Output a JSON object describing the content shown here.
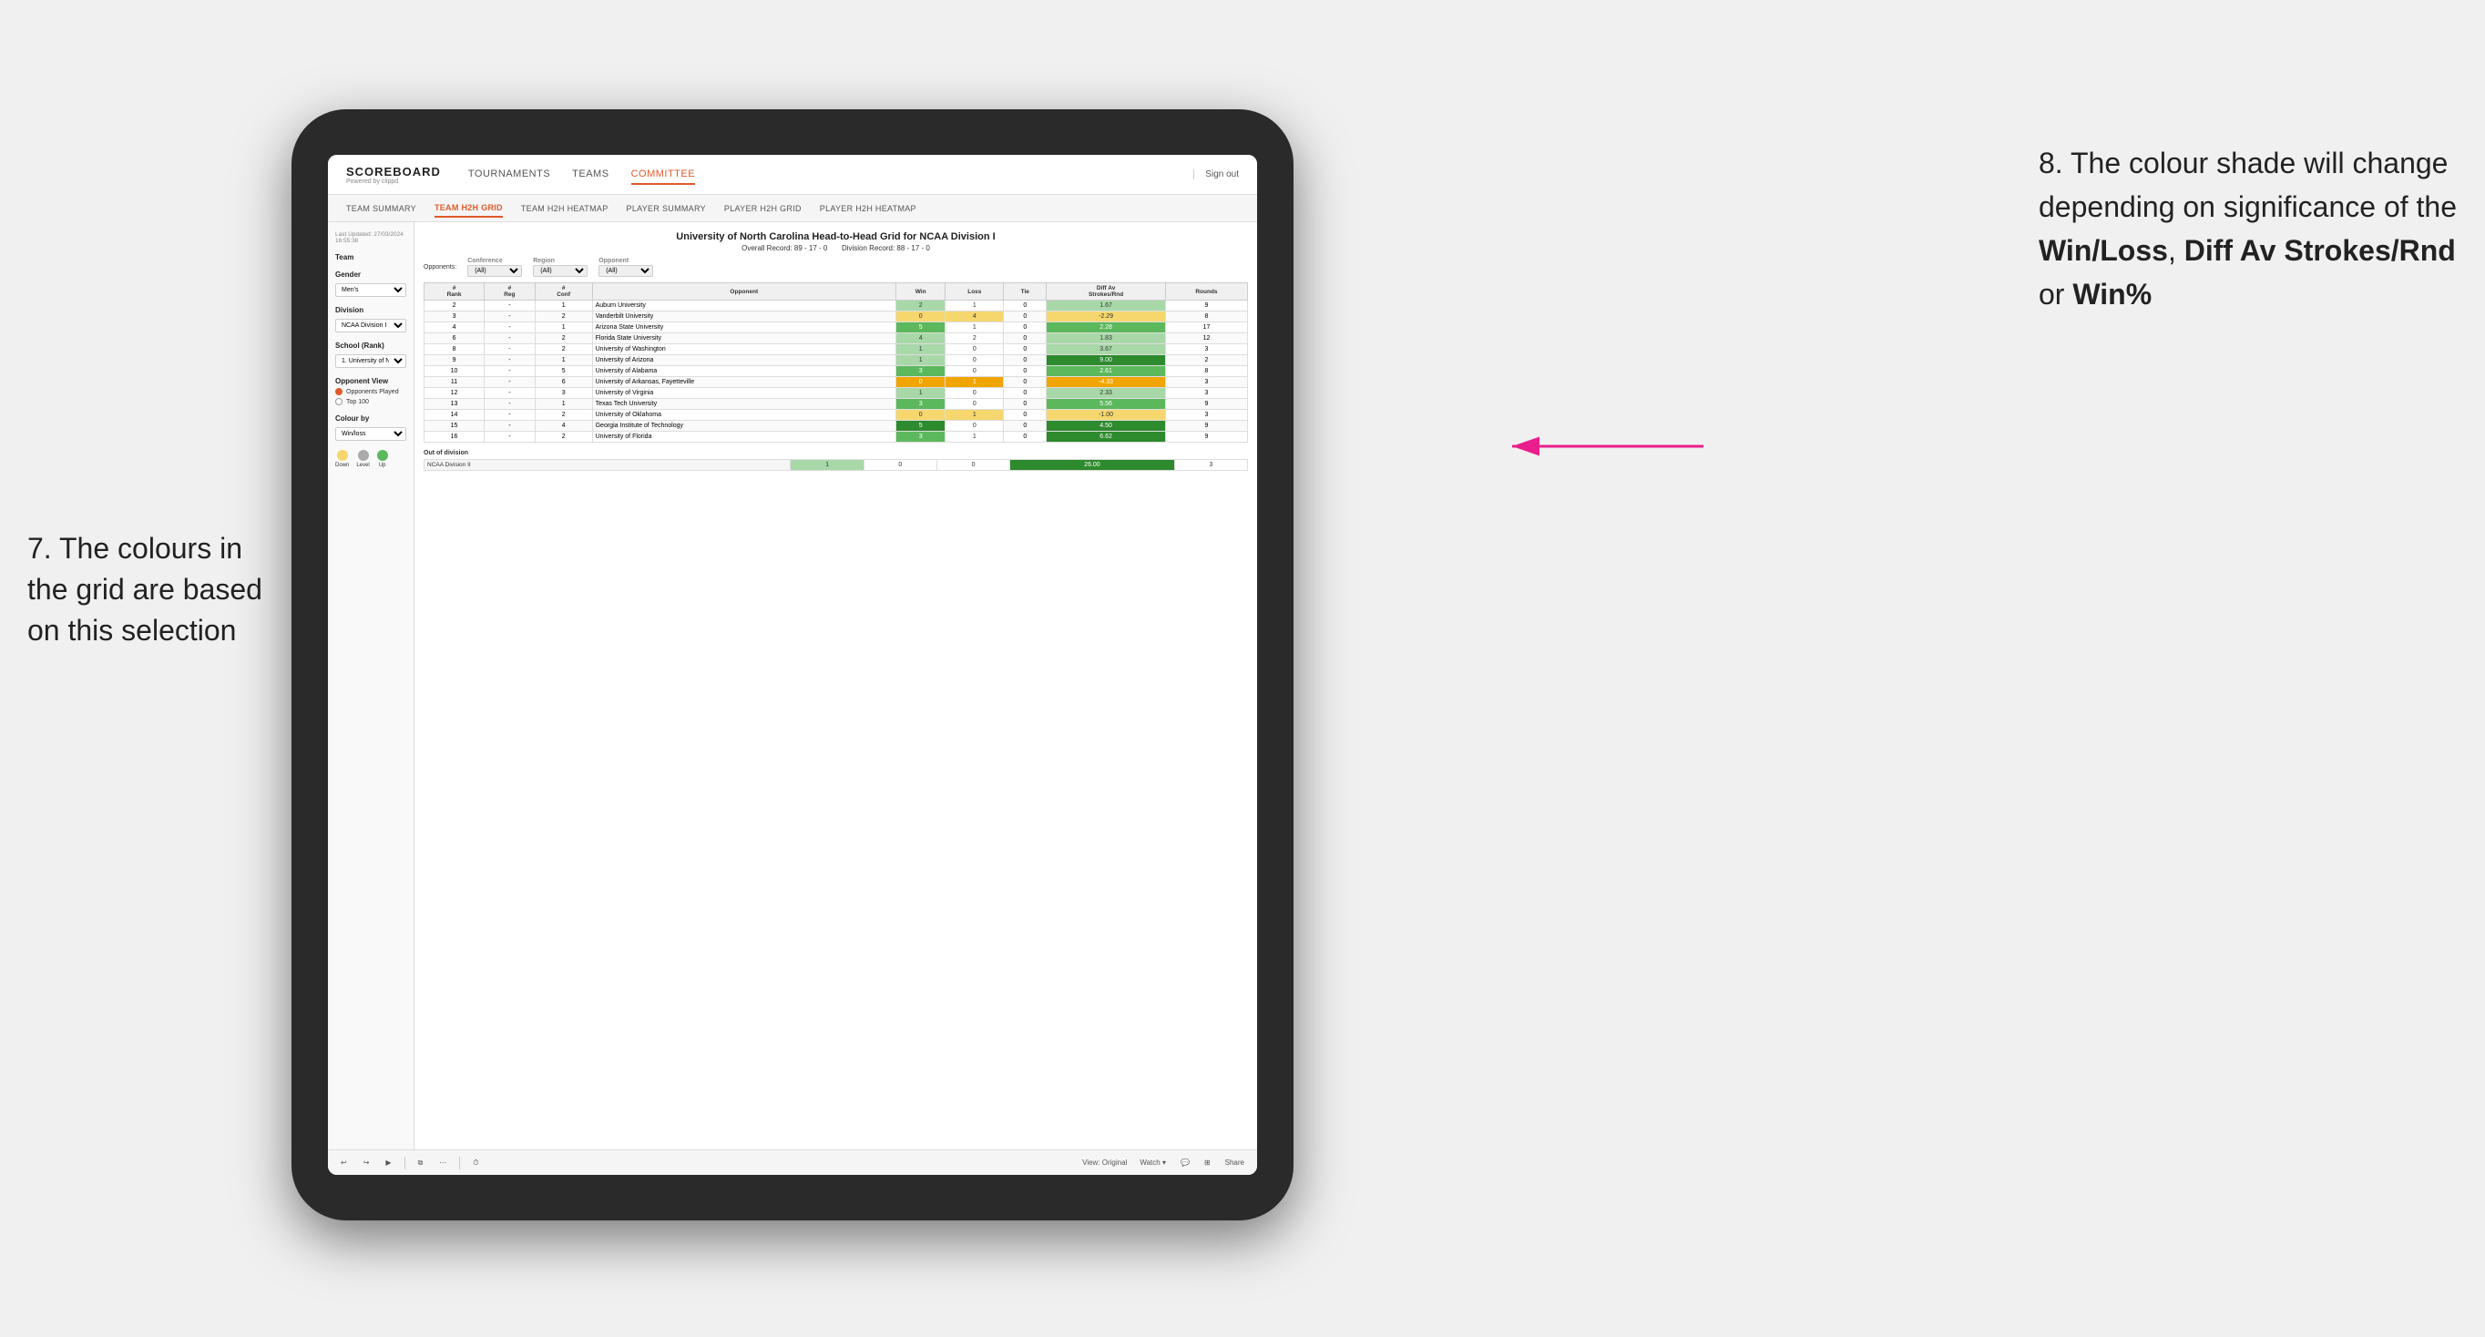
{
  "annotation_left": "7. The colours in the grid are based on this selection",
  "annotation_right_1": "8. The colour shade will change depending on significance of the ",
  "annotation_right_bold1": "Win/Loss",
  "annotation_right_2": ", ",
  "annotation_right_bold2": "Diff Av Strokes/Rnd",
  "annotation_right_3": " or ",
  "annotation_right_bold3": "Win%",
  "nav": {
    "logo": "SCOREBOARD",
    "logo_sub": "Powered by clippd",
    "items": [
      "TOURNAMENTS",
      "TEAMS",
      "COMMITTEE"
    ],
    "active": "COMMITTEE",
    "sign_out": "Sign out"
  },
  "sub_nav": {
    "items": [
      "TEAM SUMMARY",
      "TEAM H2H GRID",
      "TEAM H2H HEATMAP",
      "PLAYER SUMMARY",
      "PLAYER H2H GRID",
      "PLAYER H2H HEATMAP"
    ],
    "active": "TEAM H2H GRID"
  },
  "left_panel": {
    "timestamp": "Last Updated: 27/03/2024\n16:55:38",
    "team_label": "Team",
    "gender_label": "Gender",
    "gender_value": "Men's",
    "division_label": "Division",
    "division_value": "NCAA Division I",
    "school_label": "School (Rank)",
    "school_value": "1. University of Nort...",
    "opponent_view_label": "Opponent View",
    "radio1": "Opponents Played",
    "radio2": "Top 100",
    "colour_by_label": "Colour by",
    "colour_by_value": "Win/loss",
    "legend": [
      {
        "label": "Down",
        "color": "#f5d76e"
      },
      {
        "label": "Level",
        "color": "#aaaaaa"
      },
      {
        "label": "Up",
        "color": "#5cb85c"
      }
    ]
  },
  "grid": {
    "title": "University of North Carolina Head-to-Head Grid for NCAA Division I",
    "overall_record": "Overall Record: 89 - 17 - 0",
    "division_record": "Division Record: 88 - 17 - 0",
    "filter_opponents_label": "Opponents:",
    "filter_opponents_value": "(All)",
    "filter_conference_label": "Conference",
    "filter_conference_value": "(All)",
    "filter_region_label": "Region",
    "filter_region_value": "(All)",
    "filter_opponent_label": "Opponent",
    "filter_opponent_value": "(All)",
    "columns": [
      "#\nRank",
      "#\nReg",
      "#\nConf",
      "Opponent",
      "Win",
      "Loss",
      "Tie",
      "Diff Av\nStrokes/Rnd",
      "Rounds"
    ],
    "rows": [
      {
        "rank": "2",
        "reg": "-",
        "conf": "1",
        "opponent": "Auburn University",
        "win": "2",
        "loss": "1",
        "tie": "0",
        "diff": "1.67",
        "rounds": "9",
        "win_color": "cell-green-light",
        "loss_color": "cell-white",
        "diff_color": "cell-green-light"
      },
      {
        "rank": "3",
        "reg": "-",
        "conf": "2",
        "opponent": "Vanderbilt University",
        "win": "0",
        "loss": "4",
        "tie": "0",
        "diff": "-2.29",
        "rounds": "8",
        "win_color": "cell-yellow",
        "loss_color": "cell-yellow",
        "diff_color": "cell-yellow"
      },
      {
        "rank": "4",
        "reg": "-",
        "conf": "1",
        "opponent": "Arizona State University",
        "win": "5",
        "loss": "1",
        "tie": "0",
        "diff": "2.28",
        "rounds": "17",
        "win_color": "cell-green-med",
        "loss_color": "cell-white",
        "diff_color": "cell-green-med"
      },
      {
        "rank": "6",
        "reg": "-",
        "conf": "2",
        "opponent": "Florida State University",
        "win": "4",
        "loss": "2",
        "tie": "0",
        "diff": "1.83",
        "rounds": "12",
        "win_color": "cell-green-light",
        "loss_color": "cell-white",
        "diff_color": "cell-green-light"
      },
      {
        "rank": "8",
        "reg": "-",
        "conf": "2",
        "opponent": "University of Washington",
        "win": "1",
        "loss": "0",
        "tie": "0",
        "diff": "3.67",
        "rounds": "3",
        "win_color": "cell-green-light",
        "loss_color": "cell-white",
        "diff_color": "cell-green-light"
      },
      {
        "rank": "9",
        "reg": "-",
        "conf": "1",
        "opponent": "University of Arizona",
        "win": "1",
        "loss": "0",
        "tie": "0",
        "diff": "9.00",
        "rounds": "2",
        "win_color": "cell-green-light",
        "loss_color": "cell-white",
        "diff_color": "cell-green-dark"
      },
      {
        "rank": "10",
        "reg": "-",
        "conf": "5",
        "opponent": "University of Alabama",
        "win": "3",
        "loss": "0",
        "tie": "0",
        "diff": "2.61",
        "rounds": "8",
        "win_color": "cell-green-med",
        "loss_color": "cell-white",
        "diff_color": "cell-green-med"
      },
      {
        "rank": "11",
        "reg": "-",
        "conf": "6",
        "opponent": "University of Arkansas, Fayetteville",
        "win": "0",
        "loss": "1",
        "tie": "0",
        "diff": "-4.33",
        "rounds": "3",
        "win_color": "cell-orange",
        "loss_color": "cell-orange",
        "diff_color": "cell-orange"
      },
      {
        "rank": "12",
        "reg": "-",
        "conf": "3",
        "opponent": "University of Virginia",
        "win": "1",
        "loss": "0",
        "tie": "0",
        "diff": "2.33",
        "rounds": "3",
        "win_color": "cell-green-light",
        "loss_color": "cell-white",
        "diff_color": "cell-green-light"
      },
      {
        "rank": "13",
        "reg": "-",
        "conf": "1",
        "opponent": "Texas Tech University",
        "win": "3",
        "loss": "0",
        "tie": "0",
        "diff": "5.56",
        "rounds": "9",
        "win_color": "cell-green-med",
        "loss_color": "cell-white",
        "diff_color": "cell-green-med"
      },
      {
        "rank": "14",
        "reg": "-",
        "conf": "2",
        "opponent": "University of Oklahoma",
        "win": "0",
        "loss": "1",
        "tie": "0",
        "diff": "-1.00",
        "rounds": "3",
        "win_color": "cell-yellow",
        "loss_color": "cell-yellow",
        "diff_color": "cell-yellow"
      },
      {
        "rank": "15",
        "reg": "-",
        "conf": "4",
        "opponent": "Georgia Institute of Technology",
        "win": "5",
        "loss": "0",
        "tie": "0",
        "diff": "4.50",
        "rounds": "9",
        "win_color": "cell-green-dark",
        "loss_color": "cell-white",
        "diff_color": "cell-green-dark"
      },
      {
        "rank": "16",
        "reg": "-",
        "conf": "2",
        "opponent": "University of Florida",
        "win": "3",
        "loss": "1",
        "tie": "0",
        "diff": "6.62",
        "rounds": "9",
        "win_color": "cell-green-med",
        "loss_color": "cell-white",
        "diff_color": "cell-green-dark"
      }
    ],
    "out_of_division_label": "Out of division",
    "out_of_division_rows": [
      {
        "division": "NCAA Division II",
        "win": "1",
        "loss": "0",
        "tie": "0",
        "diff": "26.00",
        "rounds": "3",
        "diff_color": "cell-green-dark"
      }
    ]
  },
  "toolbar": {
    "view_label": "View: Original",
    "watch_label": "Watch ▾",
    "share_label": "Share"
  }
}
